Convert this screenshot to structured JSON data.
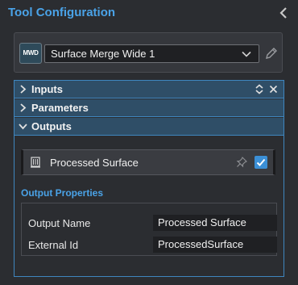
{
  "header": {
    "title": "Tool Configuration",
    "collapse_icon": "chevron-left-icon"
  },
  "tool": {
    "badge": "MWD",
    "selected": "Surface Merge Wide 1",
    "dropdown_icon": "chevron-down-icon",
    "edit_icon": "pencil-icon"
  },
  "sections": {
    "inputs": "Inputs",
    "parameters": "Parameters",
    "outputs": "Outputs"
  },
  "outputs": {
    "item": {
      "label": "Processed Surface",
      "icon": "surface-icon",
      "pin_icon": "pin-icon",
      "checked": true
    },
    "properties_title": "Output Properties",
    "properties": [
      {
        "label": "Output Name",
        "value": "Processed Surface"
      },
      {
        "label": "External Id",
        "value": "ProcessedSurface"
      }
    ]
  },
  "colors": {
    "accent": "#4aa3e8",
    "section_header": "#2f4e67",
    "checkbox": "#3b8fd6"
  }
}
